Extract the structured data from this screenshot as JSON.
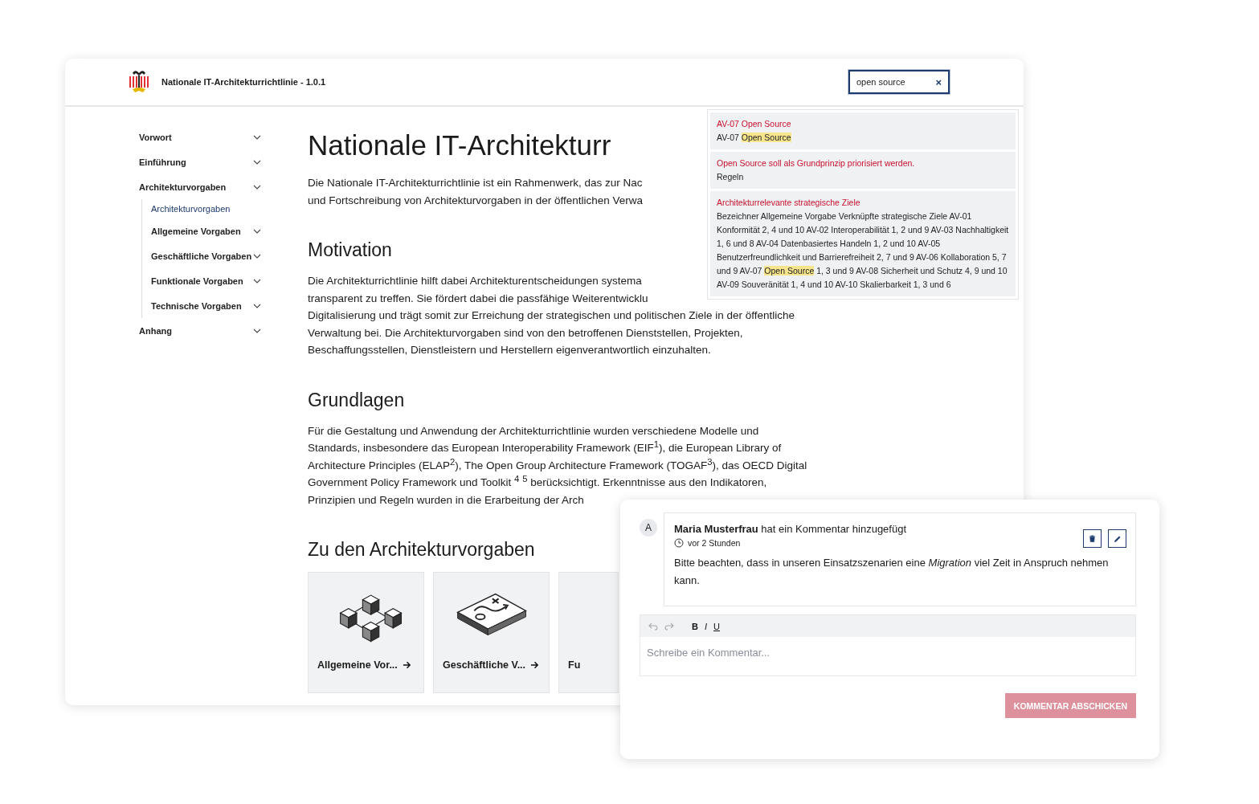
{
  "header": {
    "title": "Nationale IT-Architekturrichtlinie - 1.0.1"
  },
  "search": {
    "value": "open source",
    "clear_label": "×"
  },
  "search_results": [
    {
      "title": "AV-07 Open Source",
      "snippet": [
        {
          "text": "AV-07 ",
          "highlight": false
        },
        {
          "text": "Open Source",
          "highlight": true
        }
      ]
    },
    {
      "title": "Open Source soll als Grundprinzip priorisiert werden.",
      "snippet": [
        {
          "text": "Regeln",
          "highlight": false
        }
      ]
    },
    {
      "title": "Architekturrelevante strategische Ziele",
      "snippet": [
        {
          "text": "Bezeichner Allgemeine Vorgabe Verknüpfte strategische Ziele AV-01 Konformität 2, 4 und 10 AV-02 Interoperabilität 1, 2 und 9 AV-03 Nachhaltigkeit 1, 6 und 8 AV-04 Datenbasiertes Handeln 1, 2 und 10 AV-05 Benutzerfreundlichkeit und Barrierefreiheit 2, 7 und 9 AV-06 Kollaboration 5, 7 und 9 AV-07 ",
          "highlight": false
        },
        {
          "text": "Open Source",
          "highlight": true
        },
        {
          "text": " 1, 3 und 9 AV-08 Sicherheit und Schutz 4, 9 und 10 AV-09 Souveränität 1, 4 und 10 AV-10 Skalierbarkeit 1, 3 und 6",
          "highlight": false
        }
      ]
    }
  ],
  "sidebar": {
    "items": [
      {
        "label": "Vorwort",
        "kind": "group",
        "selected": false
      },
      {
        "label": "Einführung",
        "kind": "group",
        "selected": false
      },
      {
        "label": "Architekturvorgaben",
        "kind": "group",
        "selected": false,
        "children": [
          {
            "label": "Architekturvorgaben",
            "kind": "link",
            "selected": true
          },
          {
            "label": "Allgemeine Vorgaben",
            "kind": "group",
            "selected": false
          },
          {
            "label": "Geschäftliche Vorgaben",
            "kind": "group",
            "selected": false
          },
          {
            "label": "Funktionale Vorgaben",
            "kind": "group",
            "selected": false
          },
          {
            "label": "Technische Vorgaben",
            "kind": "group",
            "selected": false
          }
        ]
      },
      {
        "label": "Anhang",
        "kind": "group",
        "selected": false
      }
    ]
  },
  "content": {
    "title": "Nationale IT-Architekturr",
    "intro": [
      "Die Nationale IT-Architekturrichtlinie ist ein Rahmenwerk, das zur Nac",
      "und Fortschreibung von Architekturvorgaben in der öffentlichen Verwa"
    ],
    "sections": [
      {
        "heading": "Motivation",
        "blocks": [
          [
            "Die Architekturrichtlinie hilft dabei Architekturentscheidungen systema",
            "transparent zu treffen. Sie fördert dabei die passfähige Weiterentwicklu"
          ],
          [
            "Digitalisierung und trägt somit zur Erreichung der strategischen und politischen Ziele in der öffentliche",
            "Verwaltung bei. Die Architekturvorgaben sind von den betroffenen Dienststellen, Projekten,",
            "Beschaffungsstellen, Dienstleistern und Herstellern eigenverantwortlich einzuhalten."
          ]
        ]
      },
      {
        "heading": "Grundlagen",
        "blocks": [
          [
            "Für die Gestaltung und Anwendung der Architekturrichtlinie wurden verschiedene Modelle und",
            "Standards, insbesondere das European Interoperability Framework (EIF$^{1}$), die European Library of",
            "Architecture Principles (ELAP$^{2}$), The Open Group Architecture Framework (TOGAF$^{3}$), das OECD Digital",
            "Government Policy Framework und Toolkit $^{4}$ $^{5}$ berücksichtigt. Erkenntnisse aus den Indikatoren,",
            "Prinzipien und Regeln wurden in die Erarbeitung der Arch"
          ]
        ]
      }
    ],
    "cards_heading": "Zu den Architekturvorgaben",
    "cards": [
      {
        "title": "Allgemeine Vor..."
      },
      {
        "title": "Geschäftliche V..."
      },
      {
        "title": "Fu"
      }
    ]
  },
  "comments": {
    "items": [
      {
        "avatar": "A",
        "header": "**Maria Musterfrau** hat ein Kommentar hinzugefügt",
        "time": "vor 2 Stunden",
        "body": "Bitte beachten, dass in unseren Einsatzszenarien eine *Migration* viel Zeit in Anspruch nehmen kann."
      }
    ],
    "editor": {
      "tools": [
        {
          "label": "B",
          "kind": "bold"
        },
        {
          "label": "I",
          "kind": "italic"
        },
        {
          "label": "U",
          "kind": "underline"
        }
      ],
      "placeholder": "Schreibe ein Kommentar..."
    },
    "submit": {
      "label": "KOMMENTAR ABSCHICKEN",
      "disabled": true
    }
  }
}
